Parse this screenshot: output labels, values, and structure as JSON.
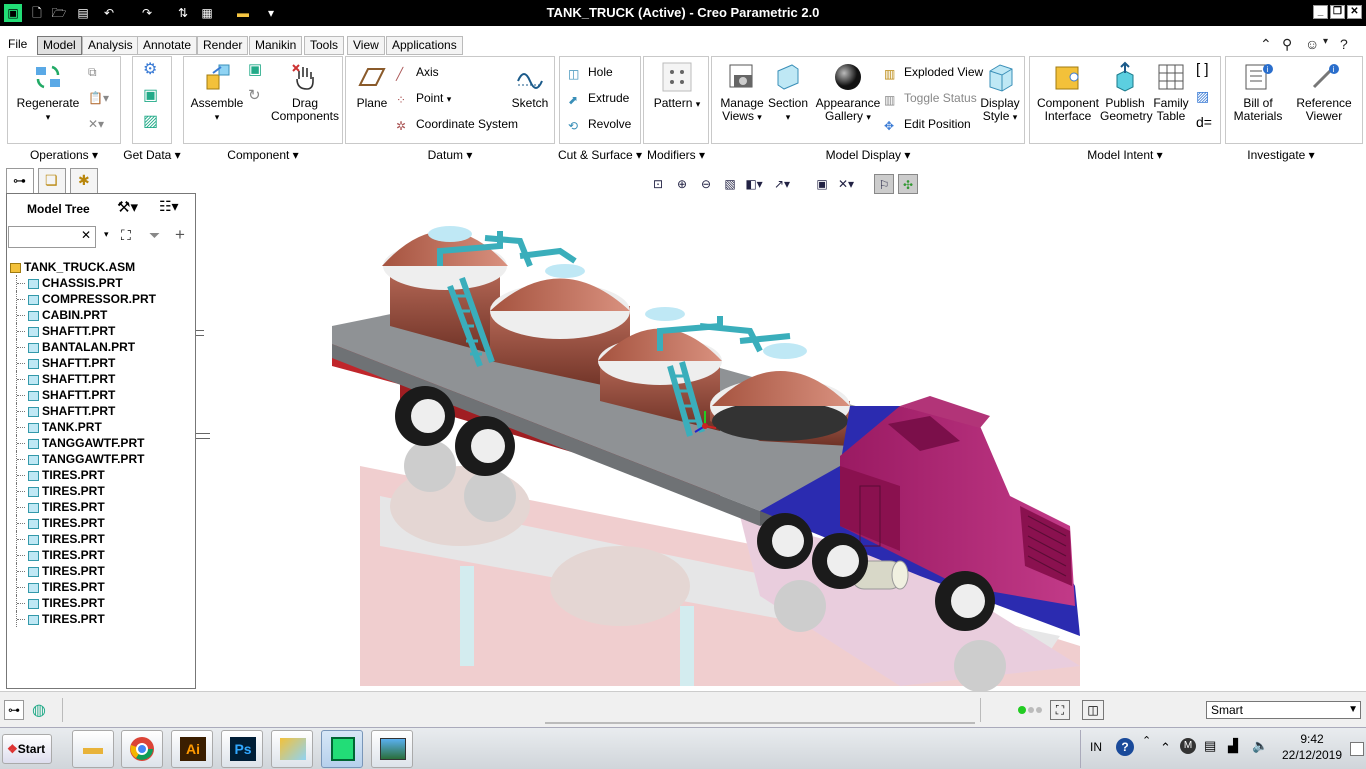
{
  "window": {
    "title": "TANK_TRUCK (Active) - Creo Parametric 2.0"
  },
  "menu": {
    "tabs": [
      "File",
      "Model",
      "Analysis",
      "Annotate",
      "Render",
      "Manikin",
      "Tools",
      "View",
      "Applications"
    ],
    "active": "Model"
  },
  "ribbon": {
    "operations": {
      "label": "Operations",
      "regenerate": "Regenerate"
    },
    "get_data": {
      "label": "Get Data"
    },
    "component": {
      "label": "Component",
      "assemble": "Assemble",
      "drag": "Drag Components"
    },
    "datum": {
      "label": "Datum",
      "plane": "Plane",
      "axis": "Axis",
      "point": "Point",
      "csys": "Coordinate System",
      "sketch": "Sketch"
    },
    "cut_surface": {
      "label": "Cut & Surface",
      "hole": "Hole",
      "extrude": "Extrude",
      "revolve": "Revolve"
    },
    "modifiers": {
      "label": "Modifiers",
      "pattern": "Pattern"
    },
    "model_display": {
      "label": "Model Display",
      "manage_views": "Manage Views",
      "section": "Section",
      "appearance": "Appearance Gallery",
      "exploded": "Exploded View",
      "toggle_status": "Toggle Status",
      "edit_position": "Edit Position",
      "display_style": "Display Style"
    },
    "model_intent": {
      "label": "Model Intent",
      "component_interface": "Component Interface",
      "publish_geometry": "Publish Geometry",
      "family_table": "Family Table",
      "d_equals": "d="
    },
    "investigate": {
      "label": "Investigate",
      "bom": "Bill of Materials",
      "ref_viewer": "Reference Viewer"
    }
  },
  "model_tree": {
    "title": "Model Tree",
    "search_value": "",
    "root": "TANK_TRUCK.ASM",
    "items": [
      "CHASSIS.PRT",
      "COMPRESSOR.PRT",
      "CABIN.PRT",
      "SHAFTT.PRT",
      "BANTALAN.PRT",
      "SHAFTT.PRT",
      "SHAFTT.PRT",
      "SHAFTT.PRT",
      "SHAFTT.PRT",
      "TANK.PRT",
      "TANGGAWTF.PRT",
      "TANGGAWTF.PRT",
      "TIRES.PRT",
      "TIRES.PRT",
      "TIRES.PRT",
      "TIRES.PRT",
      "TIRES.PRT",
      "TIRES.PRT",
      "TIRES.PRT",
      "TIRES.PRT",
      "TIRES.PRT",
      "TIRES.PRT"
    ]
  },
  "status": {
    "filter": "Smart"
  },
  "taskbar": {
    "start": "Start",
    "lang": "IN",
    "time": "9:42",
    "date": "22/12/2019",
    "app_labels": [
      "Ai",
      "Ps"
    ]
  },
  "colors": {
    "tank_body": "#8a4a3a",
    "tank_dome": "#b86a58",
    "ladder": "#3aaebb",
    "cabin": "#a0206a",
    "trailer": "#8f9295",
    "frame_red": "#c0262b"
  }
}
